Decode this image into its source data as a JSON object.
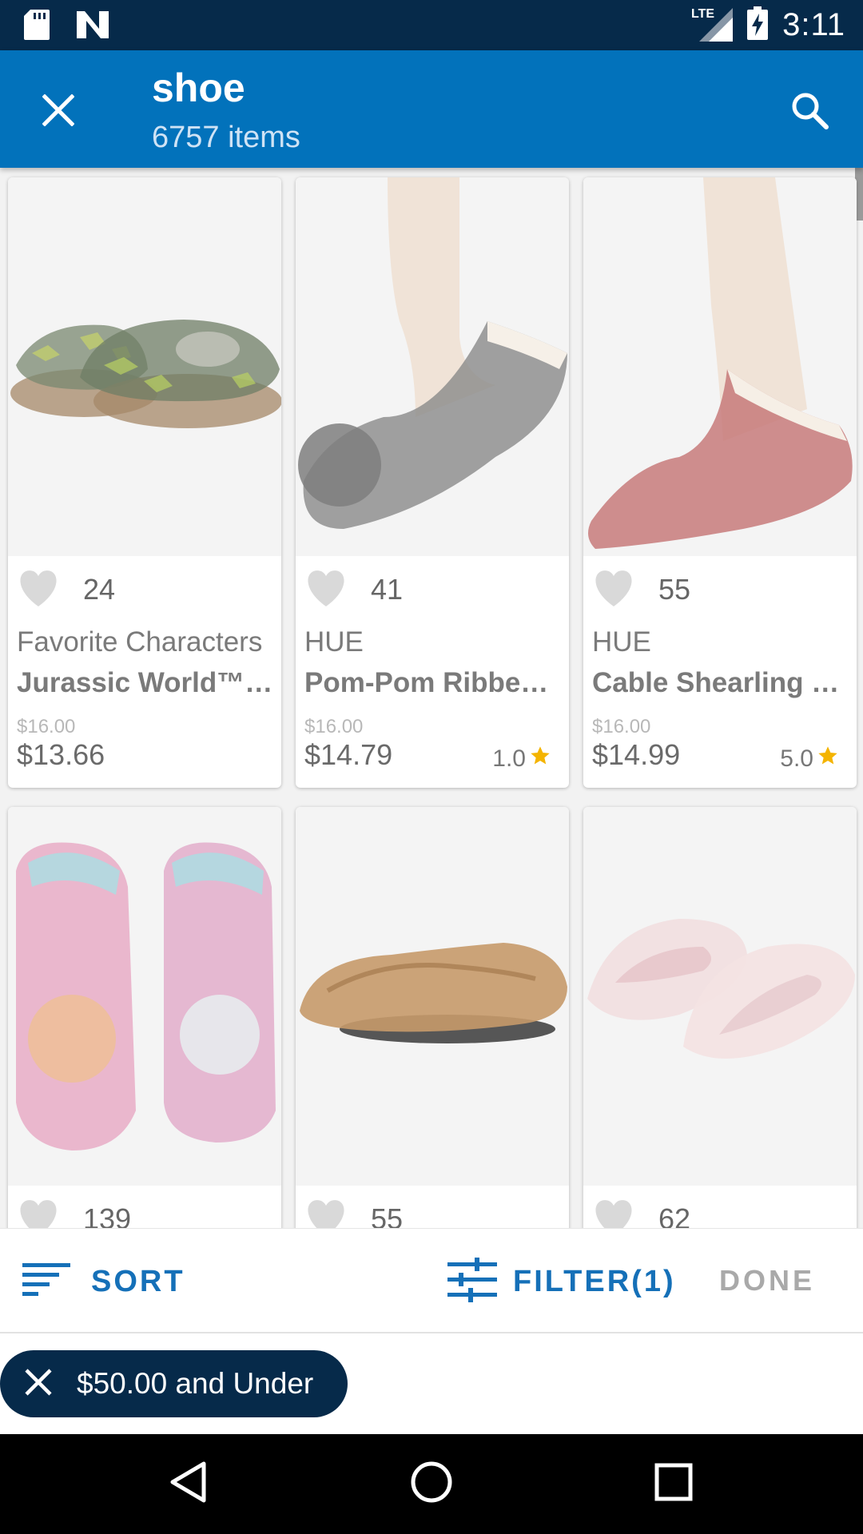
{
  "status_bar": {
    "time": "3:11",
    "network": "LTE",
    "icons": [
      "sd-card-icon",
      "n-notification-icon",
      "signal-icon",
      "battery-charging-icon"
    ]
  },
  "header": {
    "title": "shoe",
    "item_count": "6757 items",
    "icons": [
      "close-icon",
      "search-icon"
    ]
  },
  "products": [
    {
      "likes": "24",
      "brand": "Favorite Characters",
      "name": "Jurassic World™ …",
      "original_price": "$16.00",
      "price": "$13.66",
      "rating": ""
    },
    {
      "likes": "41",
      "brand": "HUE",
      "name": "Pom-Pom Ribbe…",
      "original_price": "$16.00",
      "price": "$14.79",
      "rating": "1.0"
    },
    {
      "likes": "55",
      "brand": "HUE",
      "name": "Cable Shearling …",
      "original_price": "$16.00",
      "price": "$14.99",
      "rating": "5.0"
    },
    {
      "likes": "139"
    },
    {
      "likes": "55"
    },
    {
      "likes": "62"
    }
  ],
  "actions": {
    "sort_label": "SORT",
    "filter_label": "FILTER(1)",
    "done_label": "DONE"
  },
  "active_filter": {
    "label": "$50.00 and Under"
  },
  "colors": {
    "app_bar": "#0272bb",
    "status_bar": "#062a4a",
    "accent": "#1570b8",
    "star": "#f4b400",
    "chip": "#062a4a"
  }
}
